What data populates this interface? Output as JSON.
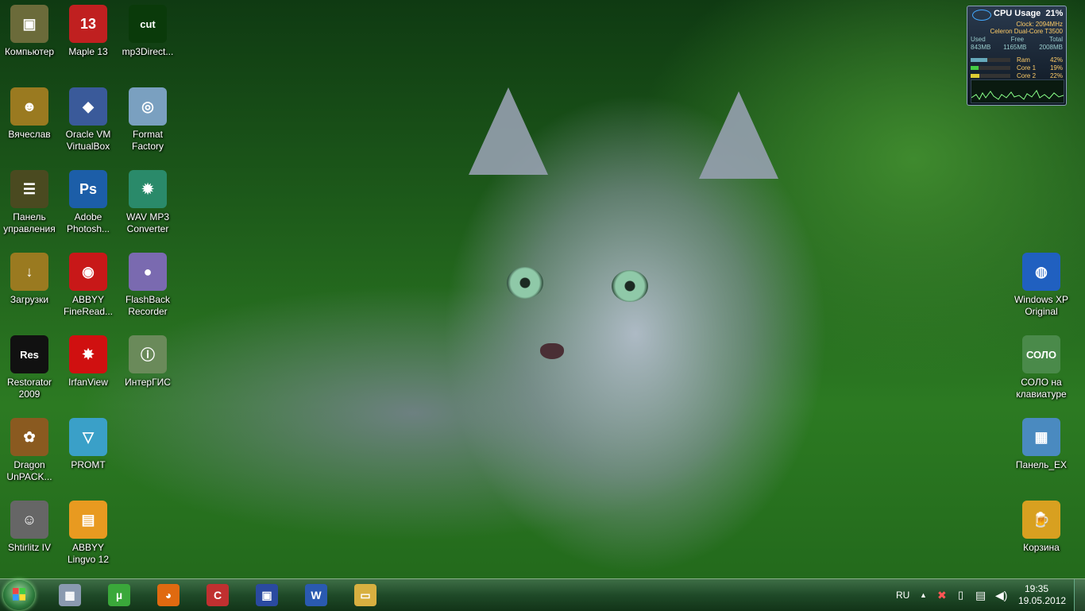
{
  "desktop": {
    "icons": [
      {
        "label": "Компьютер",
        "icon": "computer-icon",
        "color": "#6b6b3a",
        "glyph": "▣"
      },
      {
        "label": "Вячеслав",
        "icon": "user-folder-icon",
        "color": "#9a7a20",
        "glyph": "☻"
      },
      {
        "label": "Панель\nуправления",
        "icon": "control-panel-icon",
        "color": "#4a4a20",
        "glyph": "☰"
      },
      {
        "label": "Загрузки",
        "icon": "downloads-icon",
        "color": "#9a7a20",
        "glyph": "↓"
      },
      {
        "label": "Restorator\n2009",
        "icon": "restorator-icon",
        "color": "#111111",
        "glyph": "Res"
      },
      {
        "label": "Dragon\nUnPACK...",
        "icon": "dragon-unpacker-icon",
        "color": "#8a5a20",
        "glyph": "✿"
      },
      {
        "label": "Shtirlitz IV",
        "icon": "shtirlitz-icon",
        "color": "#666666",
        "glyph": "☺"
      },
      {
        "label": "Maple 13",
        "icon": "maple-icon",
        "color": "#c02020",
        "glyph": "13"
      },
      {
        "label": "Oracle VM\nVirtualBox",
        "icon": "virtualbox-icon",
        "color": "#3a5a9a",
        "glyph": "◆"
      },
      {
        "label": "Adobe\nPhotosh...",
        "icon": "photoshop-icon",
        "color": "#1c5ea8",
        "glyph": "Ps"
      },
      {
        "label": "ABBYY\nFineRead...",
        "icon": "finereader-icon",
        "color": "#c81818",
        "glyph": "◉"
      },
      {
        "label": "IrfanView",
        "icon": "irfanview-icon",
        "color": "#d01010",
        "glyph": "✸"
      },
      {
        "label": "PROMT",
        "icon": "promt-icon",
        "color": "#3aa0c8",
        "glyph": "▽"
      },
      {
        "label": "ABBYY\nLingvo 12",
        "icon": "lingvo-icon",
        "color": "#e89a20",
        "glyph": "▤"
      },
      {
        "label": "mp3Direct...",
        "icon": "mp3directcut-icon",
        "color": "#0a3a0a",
        "glyph": "cut"
      },
      {
        "label": "Format\nFactory",
        "icon": "format-factory-icon",
        "color": "#7aa0c0",
        "glyph": "◎"
      },
      {
        "label": "WAV MP3\nConverter",
        "icon": "wav-mp3-converter-icon",
        "color": "#2a8a6a",
        "glyph": "✹"
      },
      {
        "label": "FlashBack\nRecorder",
        "icon": "flashback-recorder-icon",
        "color": "#7a6ab0",
        "glyph": "●"
      },
      {
        "label": "ИнтерГИС",
        "icon": "intergis-icon",
        "color": "#6a8a5a",
        "glyph": "ⓘ"
      },
      {
        "label": "Windows XP\nOriginal",
        "icon": "globe-icon",
        "color": "#2060c0",
        "glyph": "◍"
      },
      {
        "label": "СОЛО на\nклавиатуре",
        "icon": "solo-icon",
        "color": "#4a8a4a",
        "glyph": "СОЛО"
      },
      {
        "label": "Панель_EX",
        "icon": "panel-ex-icon",
        "color": "#4a8ac0",
        "glyph": "▦"
      },
      {
        "label": "Корзина",
        "icon": "recycle-bin-icon",
        "color": "#d8a020",
        "glyph": "🍺"
      }
    ]
  },
  "gadget": {
    "title": "CPU Usage",
    "percent": "21%",
    "clock": "Clock: 2094MHz",
    "cpu_name": "Celeron Dual-Core T3500",
    "headers": [
      "Used",
      "Free",
      "Total"
    ],
    "values": [
      "843MB",
      "1165MB",
      "2008MB"
    ],
    "rows": [
      {
        "label": "Ram",
        "value": "42%",
        "level": 0.42
      },
      {
        "label": "Core 1",
        "value": "19%",
        "level": 0.19
      },
      {
        "label": "Core 2",
        "value": "22%",
        "level": 0.22
      }
    ]
  },
  "taskbar": {
    "start_icon": "windows-start-icon",
    "pinned": [
      {
        "icon": "calculator-icon",
        "color": "#8a9ab0",
        "glyph": "▦"
      },
      {
        "icon": "utorrent-icon",
        "color": "#3aa83a",
        "glyph": "µ"
      },
      {
        "icon": "firefox-icon",
        "color": "#e06a10",
        "glyph": "◕"
      },
      {
        "icon": "ccleaner-icon",
        "color": "#c03030",
        "glyph": "C"
      },
      {
        "icon": "floppy-save-icon",
        "color": "#2a4aa0",
        "glyph": "▣"
      },
      {
        "icon": "word-icon",
        "color": "#2a5ab0",
        "glyph": "W"
      },
      {
        "icon": "explorer-folder-icon",
        "color": "#d8b040",
        "glyph": "▭"
      }
    ],
    "language": "RU",
    "time": "19:35",
    "date": "19.05.2012"
  }
}
